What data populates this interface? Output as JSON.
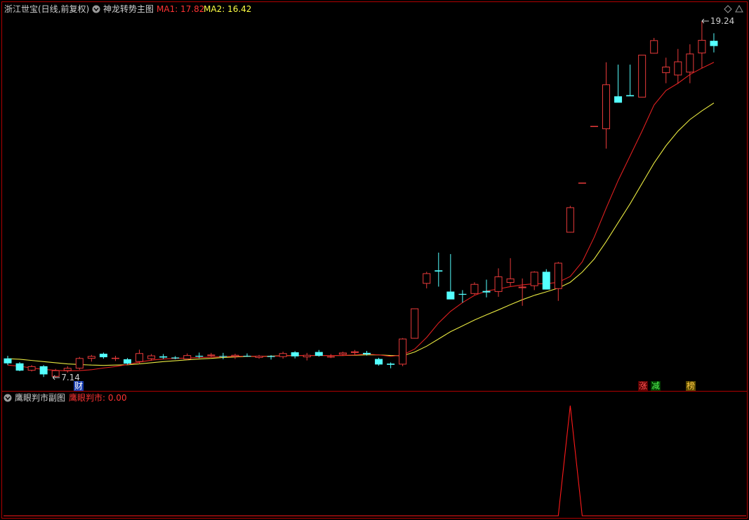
{
  "header": {
    "stock_label": "浙江世宝(日线,前复权)",
    "main_indicator": "神龙转势主图",
    "ma1_label": "MA1: 17.82",
    "ma2_label": "MA2: 16.42"
  },
  "sub": {
    "indicator_name": "鹰眼判市副图",
    "value_label": "鹰眼判市: 0.00"
  },
  "markers": {
    "high_label": "19.24",
    "low_label": "7.14",
    "cai": "财",
    "zhang": "涨",
    "jian": "减",
    "bang": "榜"
  },
  "colors": {
    "background": "#000000",
    "frame": "#b00000",
    "up": "#e83a3a",
    "down": "#54ffff",
    "ma1": "#e02020",
    "ma2": "#e8e840",
    "text": "#d0d0d0",
    "sub_line": "#ff1a1a"
  },
  "chart_data": {
    "type": "candlestick",
    "ohlc": [
      [
        7.63,
        7.72,
        7.4,
        7.46
      ],
      [
        7.46,
        7.5,
        7.19,
        7.21
      ],
      [
        7.21,
        7.4,
        7.18,
        7.36
      ],
      [
        7.36,
        7.4,
        6.99,
        7.08
      ],
      [
        7.0,
        7.27,
        6.96,
        7.22
      ],
      [
        7.2,
        7.36,
        7.14,
        7.3
      ],
      [
        7.28,
        7.68,
        7.24,
        7.64
      ],
      [
        7.62,
        7.75,
        7.52,
        7.71
      ],
      [
        7.79,
        7.83,
        7.62,
        7.67
      ],
      [
        7.64,
        7.72,
        7.54,
        7.65
      ],
      [
        7.6,
        7.64,
        7.42,
        7.45
      ],
      [
        7.51,
        7.93,
        7.44,
        7.81
      ],
      [
        7.61,
        7.78,
        7.55,
        7.73
      ],
      [
        7.7,
        7.78,
        7.61,
        7.66
      ],
      [
        7.66,
        7.71,
        7.6,
        7.63
      ],
      [
        7.6,
        7.8,
        7.57,
        7.74
      ],
      [
        7.72,
        7.83,
        7.64,
        7.69
      ],
      [
        7.71,
        7.82,
        7.68,
        7.76
      ],
      [
        7.71,
        7.82,
        7.6,
        7.7
      ],
      [
        7.69,
        7.79,
        7.61,
        7.75
      ],
      [
        7.72,
        7.8,
        7.68,
        7.71
      ],
      [
        7.65,
        7.75,
        7.62,
        7.72
      ],
      [
        7.71,
        7.74,
        7.59,
        7.68
      ],
      [
        7.68,
        7.86,
        7.62,
        7.81
      ],
      [
        7.84,
        7.88,
        7.63,
        7.7
      ],
      [
        7.67,
        7.82,
        7.56,
        7.75
      ],
      [
        7.85,
        7.92,
        7.69,
        7.72
      ],
      [
        7.68,
        7.78,
        7.64,
        7.7
      ],
      [
        7.76,
        7.86,
        7.72,
        7.83
      ],
      [
        7.82,
        7.92,
        7.75,
        7.87
      ],
      [
        7.82,
        7.89,
        7.73,
        7.77
      ],
      [
        7.61,
        7.65,
        7.38,
        7.42
      ],
      [
        7.45,
        7.49,
        7.29,
        7.41
      ],
      [
        7.42,
        8.33,
        7.36,
        8.31
      ],
      [
        8.31,
        9.35,
        8.31,
        9.35
      ],
      [
        10.2,
        10.61,
        10.04,
        10.56
      ],
      [
        10.66,
        11.27,
        10.1,
        10.62
      ],
      [
        9.93,
        11.22,
        9.75,
        9.66
      ],
      [
        9.85,
        9.98,
        9.55,
        9.82
      ],
      [
        9.85,
        10.25,
        9.82,
        10.19
      ],
      [
        9.95,
        10.34,
        9.73,
        9.9
      ],
      [
        9.92,
        10.73,
        9.75,
        10.45
      ],
      [
        10.23,
        11.08,
        10.12,
        10.38
      ],
      [
        10.05,
        10.38,
        9.44,
        10.1
      ],
      [
        10.12,
        10.63,
        9.98,
        10.61
      ],
      [
        10.61,
        10.7,
        10.02,
        10.0
      ],
      [
        10.02,
        10.95,
        9.61,
        10.92
      ],
      [
        11.96,
        12.88,
        11.96,
        12.83
      ],
      [
        13.68,
        13.68,
        13.68,
        13.68
      ],
      [
        15.63,
        15.63,
        15.63,
        15.63
      ],
      [
        15.52,
        17.82,
        14.85,
        17.06
      ],
      [
        16.65,
        17.74,
        16.5,
        16.43
      ],
      [
        16.69,
        17.74,
        16.69,
        16.65
      ],
      [
        16.61,
        17.8,
        16.61,
        18.08
      ],
      [
        18.12,
        18.66,
        18.12,
        18.58
      ],
      [
        17.45,
        17.98,
        17.1,
        17.67
      ],
      [
        17.37,
        18.28,
        17.08,
        17.85
      ],
      [
        17.47,
        18.44,
        17.1,
        18.12
      ],
      [
        18.13,
        19.24,
        17.62,
        18.59
      ],
      [
        18.56,
        18.82,
        18.16,
        18.38
      ]
    ],
    "ma1": [
      7.4,
      7.36,
      7.3,
      7.25,
      7.22,
      7.2,
      7.21,
      7.24,
      7.3,
      7.35,
      7.42,
      7.5,
      7.57,
      7.61,
      7.63,
      7.64,
      7.66,
      7.67,
      7.69,
      7.7,
      7.71,
      7.7,
      7.7,
      7.72,
      7.73,
      7.73,
      7.73,
      7.73,
      7.73,
      7.75,
      7.78,
      7.75,
      7.7,
      7.75,
      7.95,
      8.35,
      8.85,
      9.25,
      9.55,
      9.8,
      9.95,
      10.02,
      10.1,
      10.16,
      10.2,
      10.2,
      10.25,
      10.45,
      10.95,
      11.8,
      12.8,
      13.75,
      14.6,
      15.45,
      16.35,
      16.85,
      17.1,
      17.4,
      17.62,
      17.82
    ],
    "ma2": [
      7.62,
      7.6,
      7.56,
      7.52,
      7.48,
      7.44,
      7.42,
      7.4,
      7.39,
      7.4,
      7.41,
      7.44,
      7.48,
      7.52,
      7.55,
      7.58,
      7.61,
      7.63,
      7.66,
      7.68,
      7.7,
      7.7,
      7.71,
      7.72,
      7.73,
      7.73,
      7.73,
      7.73,
      7.73,
      7.74,
      7.75,
      7.75,
      7.73,
      7.72,
      7.85,
      8.05,
      8.3,
      8.55,
      8.75,
      8.95,
      9.13,
      9.3,
      9.48,
      9.65,
      9.8,
      9.92,
      10.05,
      10.25,
      10.6,
      11.05,
      11.65,
      12.3,
      12.95,
      13.65,
      14.35,
      14.95,
      15.45,
      15.85,
      16.15,
      16.42
    ],
    "sub_values": [
      0,
      0,
      0,
      0,
      0,
      0,
      0,
      0,
      0,
      0,
      0,
      0,
      0,
      0,
      0,
      0,
      0,
      0,
      0,
      0,
      0,
      0,
      0,
      0,
      0,
      0,
      0,
      0,
      0,
      0,
      0,
      0,
      0,
      0,
      0,
      0,
      0,
      0,
      0,
      0,
      0,
      0,
      0,
      0,
      0,
      0,
      0,
      1,
      0,
      0,
      0,
      0,
      0,
      0,
      0,
      0,
      0,
      0,
      0,
      0
    ],
    "high": 19.24,
    "low": 7.14
  }
}
